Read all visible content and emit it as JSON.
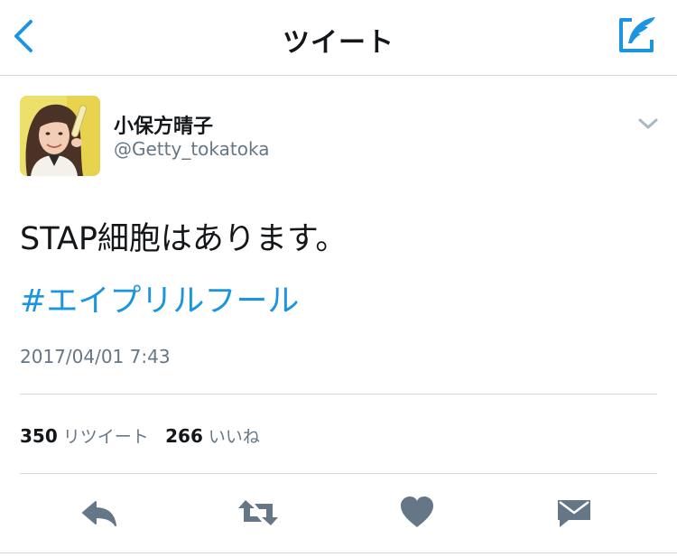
{
  "navbar": {
    "title": "ツイート",
    "back_icon": "chevron-left-icon",
    "compose_icon": "compose-quill-icon",
    "accent_color": "#1b95e0"
  },
  "tweet": {
    "author_name": "小保方晴子",
    "author_handle": "@Getty_tokatoka",
    "text": "STAP細胞はあります。",
    "hashtag": "#エイプリルフール",
    "timestamp": "2017/04/01 7:43",
    "hashtag_color": "#1b95e0"
  },
  "stats": {
    "retweets_count": "350",
    "retweets_label": "リツイート",
    "likes_count": "266",
    "likes_label": "いいね"
  },
  "actions": {
    "icon_color": "#657786",
    "items": [
      "reply-icon",
      "retweet-icon",
      "like-heart-icon",
      "direct-message-icon"
    ]
  }
}
